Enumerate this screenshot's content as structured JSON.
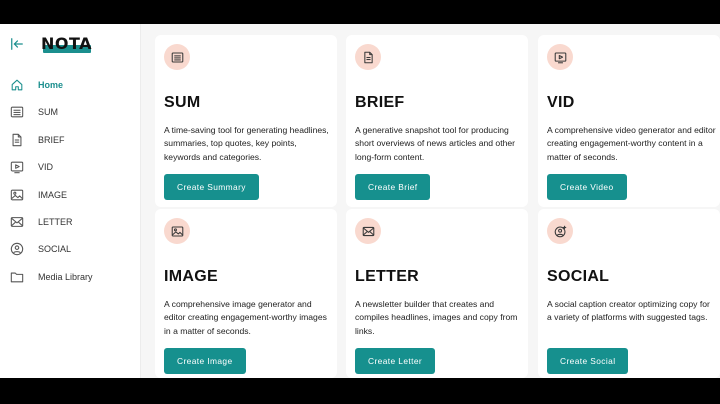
{
  "sidebar": {
    "logo_text": "NOTA",
    "items": [
      {
        "label": "Home",
        "icon": "home-icon"
      },
      {
        "label": "SUM",
        "icon": "list-icon"
      },
      {
        "label": "BRIEF",
        "icon": "document-icon"
      },
      {
        "label": "VID",
        "icon": "video-icon"
      },
      {
        "label": "IMAGE",
        "icon": "image-icon"
      },
      {
        "label": "LETTER",
        "icon": "envelope-icon"
      },
      {
        "label": "SOCIAL",
        "icon": "user-circle-icon"
      },
      {
        "label": "Media Library",
        "icon": "folder-icon"
      }
    ]
  },
  "cards": [
    {
      "title": "SUM",
      "description": "A time-saving tool for generating headlines, summaries, top quotes, key points, keywords and categories.",
      "button": "Create Summary",
      "icon": "list-icon"
    },
    {
      "title": "BRIEF",
      "description": "A generative snapshot tool for producing short overviews of news articles and other long-form content.",
      "button": "Create Brief",
      "icon": "document-icon"
    },
    {
      "title": "VID",
      "description": "A comprehensive video generator and editor creating engagement-worthy content in a matter of seconds.",
      "button": "Create Video",
      "icon": "video-icon"
    },
    {
      "title": "IMAGE",
      "description": "A comprehensive image generator and editor creating engagement-worthy images in a matter of seconds.",
      "button": "Create Image",
      "icon": "image-icon"
    },
    {
      "title": "LETTER",
      "description": "A newsletter builder that creates and compiles headlines, images and copy from links.",
      "button": "Create Letter",
      "icon": "envelope-icon"
    },
    {
      "title": "SOCIAL",
      "description": "A social caption creator optimizing copy for a variety of platforms with suggested tags.",
      "button": "Create Social",
      "icon": "user-plus-icon"
    }
  ],
  "colors": {
    "accent": "#16908e",
    "icon_bg": "#f9d9cf",
    "background": "#f6f6f6"
  }
}
